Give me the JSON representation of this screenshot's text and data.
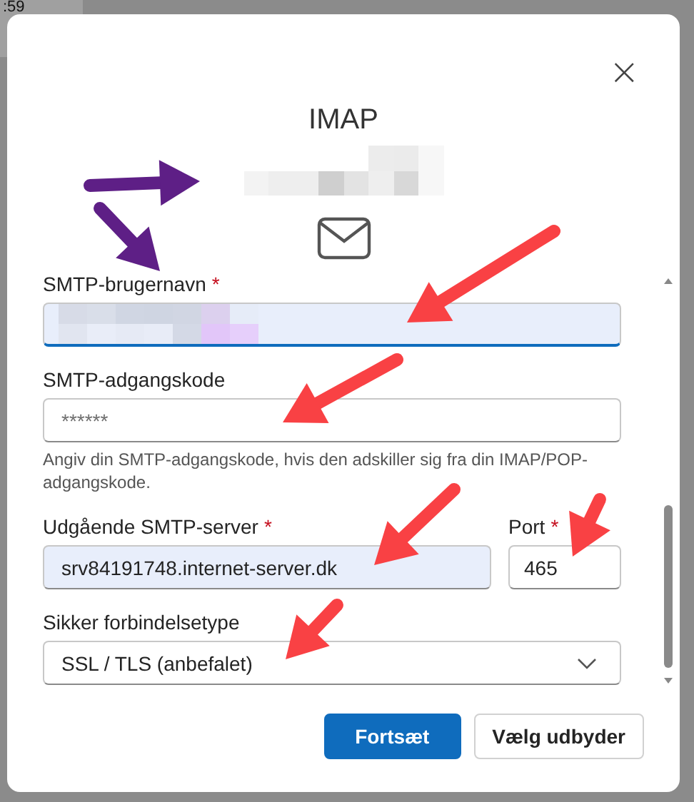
{
  "background": {
    "texts": [
      ":59"
    ]
  },
  "dialog": {
    "title": "IMAP",
    "account": {
      "kind": "redacted"
    },
    "close": "×",
    "required_mark": "*",
    "fields": [
      {
        "kind": "text",
        "label": "SMTP-brugernavn",
        "required": true,
        "value_redacted": true,
        "focused": true
      },
      {
        "kind": "password",
        "label": "SMTP-adgangskode",
        "required": false,
        "placeholder": "******",
        "help": "Angiv din SMTP-adgangskode, hvis den adskiller sig fra din IMAP/POP-adgangskode."
      },
      {
        "kind": "pair",
        "label": "Udgående SMTP-server",
        "required": true,
        "value": "srv84191748.internet-server.dk",
        "autofilled": true,
        "side_label": "Port",
        "side_required": true,
        "side_value": "465"
      },
      {
        "kind": "select",
        "label": "Sikker forbindelsetype",
        "required": false,
        "value": "SSL / TLS (anbefalet)"
      }
    ],
    "buttons": [
      {
        "label": "Fortsæt",
        "primary": true
      },
      {
        "label": "Vælg udbyder",
        "primary": false
      }
    ]
  },
  "annotations": [
    {
      "color": "#5e1f86"
    },
    {
      "color": "#5e1f86"
    },
    {
      "color": "#f94144"
    },
    {
      "color": "#f94144"
    },
    {
      "color": "#f94144"
    },
    {
      "color": "#f94144"
    },
    {
      "color": "#f94144"
    }
  ]
}
